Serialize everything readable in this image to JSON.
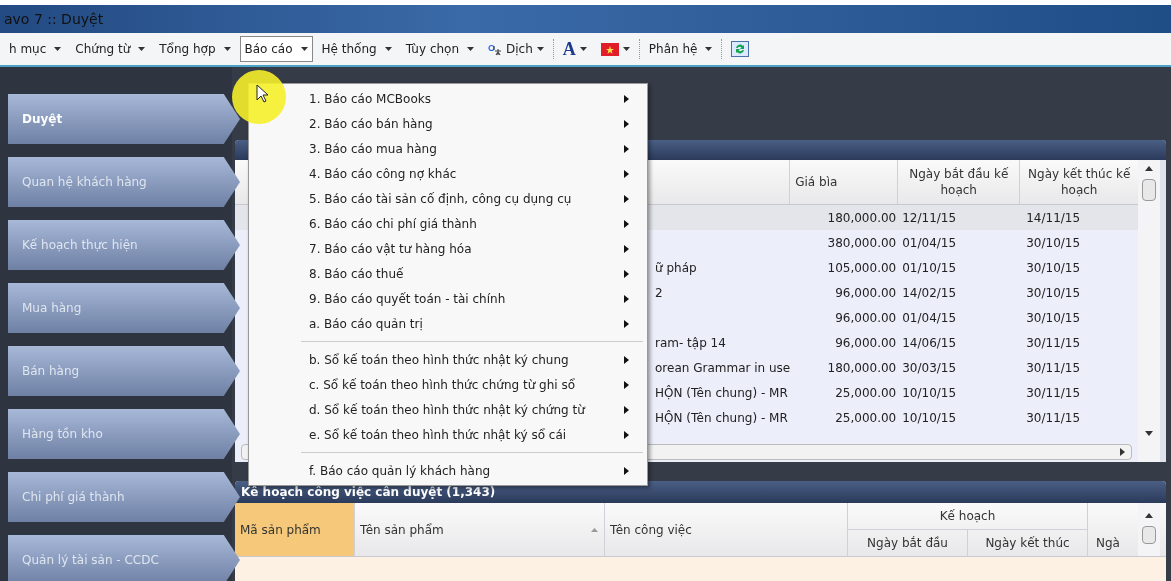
{
  "window": {
    "title": "avo 7 :: Duyệt"
  },
  "toolbar": {
    "menus": [
      {
        "label": "h mục",
        "kind": "menu",
        "selected": false
      },
      {
        "label": "Chứng từ",
        "kind": "menu",
        "selected": false
      },
      {
        "label": "Tổng hợp",
        "kind": "menu",
        "selected": false
      },
      {
        "label": "Báo cáo",
        "kind": "menu",
        "selected": true
      },
      {
        "label": "Hệ thống",
        "kind": "menu",
        "selected": false
      },
      {
        "label": "Tùy chọn",
        "kind": "menu",
        "selected": false
      },
      {
        "label": "Dịch",
        "kind": "translate",
        "selected": false
      },
      {
        "label": "A",
        "kind": "font",
        "selected": false
      },
      {
        "kind": "flag",
        "selected": false
      },
      {
        "label": "Phân hệ",
        "kind": "menu",
        "selected": false
      },
      {
        "kind": "refresh",
        "selected": false
      }
    ]
  },
  "sidebar": {
    "items": [
      {
        "label": "Duyệt",
        "selected": true
      },
      {
        "label": "Quan hệ khách hàng",
        "selected": false
      },
      {
        "label": "Kế hoạch thực hiện",
        "selected": false
      },
      {
        "label": "Mua hàng",
        "selected": false
      },
      {
        "label": "Bán hàng",
        "selected": false
      },
      {
        "label": "Hàng tồn kho",
        "selected": false
      },
      {
        "label": "Chi phí giá thành",
        "selected": false
      },
      {
        "label": "Quản lý tài sản - CCDC",
        "selected": false
      }
    ]
  },
  "dropdown_menu": {
    "groups": [
      [
        {
          "label": "1. Báo cáo MCBooks",
          "has_submenu": true
        },
        {
          "label": "2. Báo cáo bán hàng",
          "has_submenu": true
        },
        {
          "label": "3. Báo cáo mua hàng",
          "has_submenu": true
        },
        {
          "label": "4. Báo cáo công nợ khác",
          "has_submenu": true
        },
        {
          "label": "5. Báo cáo tài sản cố định, công cụ dụng cụ",
          "has_submenu": true
        },
        {
          "label": "6. Báo cáo chi phí giá thành",
          "has_submenu": true
        },
        {
          "label": "7. Báo cáo vật tư hàng hóa",
          "has_submenu": true
        },
        {
          "label": "8. Báo cáo thuế",
          "has_submenu": true
        },
        {
          "label": "9. Báo cáo quyết toán - tài chính",
          "has_submenu": true
        },
        {
          "label": "a. Báo cáo quản trị",
          "has_submenu": true
        }
      ],
      [
        {
          "label": "b. Sổ kế toán theo hình thức nhật ký chung",
          "has_submenu": true
        },
        {
          "label": "c. Sổ kế toán theo hình thức chứng từ ghi sổ",
          "has_submenu": true
        },
        {
          "label": "d. Sổ kế toán theo hình thức nhật ký chứng từ",
          "has_submenu": true
        },
        {
          "label": "e. Sổ kế toán theo hình thức nhật ký sổ cái",
          "has_submenu": true
        }
      ],
      [
        {
          "label": "f. Báo cáo quản lý khách hàng",
          "has_submenu": true
        }
      ]
    ]
  },
  "top_grid": {
    "columns": [
      "Giá bìa",
      "Ngày bắt đầu kế hoạch",
      "Ngày kết thúc kế hoạch"
    ],
    "rows": [
      {
        "price": "180,000.00",
        "start": "12/11/15",
        "end": "14/11/15",
        "selected": true
      },
      {
        "price": "380,000.00",
        "start": "01/04/15",
        "end": "30/10/15",
        "selected": false
      },
      {
        "column_1": "ữ pháp",
        "price": "105,000.00",
        "start": "01/10/15",
        "end": "30/10/15",
        "selected": false
      },
      {
        "column_1": "2",
        "price": "96,000.00",
        "start": "14/02/15",
        "end": "30/10/15",
        "selected": false
      },
      {
        "price": "96,000.00",
        "start": "01/04/15",
        "end": "30/10/15",
        "selected": false
      },
      {
        "column_1": "ram- tập 14",
        "price": "96,000.00",
        "start": "14/06/15",
        "end": "30/11/15",
        "selected": false
      },
      {
        "column_1": "orean Grammar in use",
        "price": "180,000.00",
        "start": "30/03/15",
        "end": "30/11/15",
        "selected": false
      },
      {
        "column_1": "HỘN (Tên chung) - MR",
        "price": "25,000.00",
        "start": "10/10/15",
        "end": "30/11/15",
        "selected": false
      },
      {
        "column_1": "HỘN (Tên chung) - MR",
        "price": "25,000.00",
        "start": "10/10/15",
        "end": "30/11/15",
        "selected": false
      }
    ]
  },
  "bottom_grid": {
    "title": "Kế hoạch công việc cần duyệt (1,343)",
    "columns": [
      {
        "label": "Mã sản phẩm",
        "selected": true
      },
      {
        "label": "Tên sản phẩm",
        "selected": false
      },
      {
        "label": "Tên công việc",
        "selected": false
      }
    ],
    "group": {
      "label": "Kế hoạch",
      "columns": [
        "Ngày bắt đầu",
        "Ngày kết thúc"
      ]
    },
    "column_7": "Ngà"
  }
}
